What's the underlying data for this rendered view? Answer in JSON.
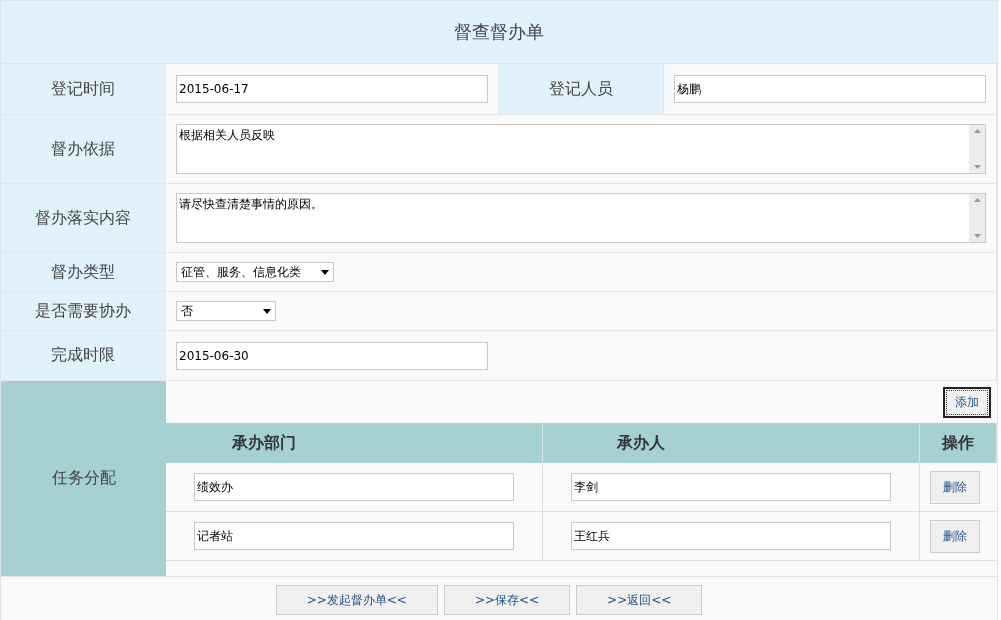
{
  "title": "督查督办单",
  "rows": [
    {
      "cells": [
        {
          "label": "登记时间",
          "kind": "input",
          "value": "2015-06-17"
        },
        {
          "label": "登记人员",
          "kind": "input",
          "value": "杨鹏"
        }
      ]
    },
    {
      "cells": [
        {
          "label": "督办依据",
          "kind": "textarea",
          "value": "根据相关人员反映"
        }
      ]
    },
    {
      "cells": [
        {
          "label": "督办落实内容",
          "kind": "textarea",
          "value": "请尽快查清楚事情的原因。"
        }
      ]
    },
    {
      "cells": [
        {
          "label": "督办类型",
          "kind": "select",
          "value": "征管、服务、信息化类"
        }
      ]
    },
    {
      "cells": [
        {
          "label": "是否需要协办",
          "kind": "select",
          "value": "否"
        }
      ]
    },
    {
      "cells": [
        {
          "label": "完成时限",
          "kind": "input",
          "value": "2015-06-30"
        }
      ]
    }
  ],
  "tasks": {
    "label": "任务分配",
    "add_button": "添加",
    "columns": [
      "承办部门",
      "承办人",
      "操作"
    ],
    "rows": [
      {
        "department": "绩效办",
        "handler": "李剑",
        "action": "删除"
      },
      {
        "department": "记者站",
        "handler": "王红兵",
        "action": "删除"
      }
    ]
  },
  "buttons": [
    ">>发起督办单<<",
    ">>保存<<",
    ">>返回<<"
  ]
}
